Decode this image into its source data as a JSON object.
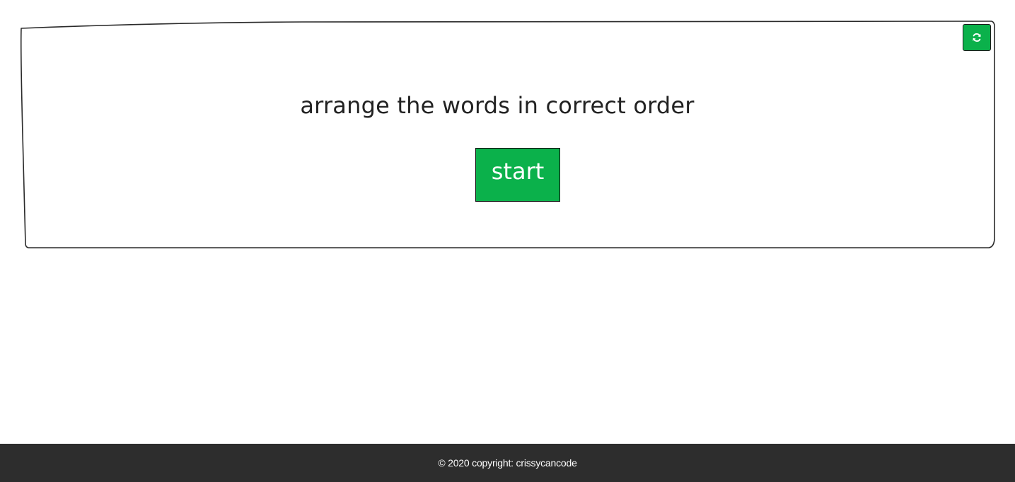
{
  "game": {
    "instruction": "arrange the words in correct order",
    "start_label": "start",
    "reset_icon": "refresh-icon"
  },
  "footer": {
    "copyright": "© 2020 copyright: crissycancode"
  },
  "colors": {
    "accent_green": "#0bb14b",
    "footer_bg": "#2d2d2d",
    "text_dark": "#222222"
  }
}
